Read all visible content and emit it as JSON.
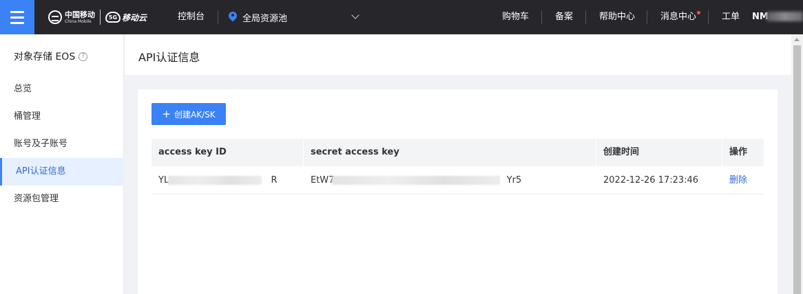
{
  "topbar": {
    "brand_cn": "中国移动",
    "brand_en": "China Mobile",
    "cloud_badge": "5G",
    "cloud_name": "移动云",
    "console": "控制台",
    "region": "全局资源池",
    "links": [
      "购物车",
      "备案",
      "帮助中心",
      "消息中心",
      "工单"
    ],
    "user_visible": "NM"
  },
  "sidebar": {
    "title": "对象存储 EOS",
    "help_glyph": "?",
    "items": [
      {
        "label": "总览"
      },
      {
        "label": "桶管理"
      },
      {
        "label": "账号及子账号"
      },
      {
        "label": "API认证信息"
      },
      {
        "label": "资源包管理"
      }
    ],
    "active_index": 3
  },
  "page": {
    "title": "API认证信息",
    "create_button": "创建AK/SK",
    "create_plus": "+"
  },
  "table": {
    "columns": [
      "access key ID",
      "secret access key",
      "创建时间",
      "操作"
    ],
    "rows": [
      {
        "access_key_start": "YL",
        "access_key_end": "R",
        "secret_start": "EtW7",
        "secret_end": "Yr5",
        "created": "2022-12-26 17:23:46",
        "action": "删除"
      }
    ]
  },
  "colors": {
    "topbar_bg": "#26262b",
    "accent": "#3b82f6",
    "link": "#2f6bd9",
    "notification_dot": "#ff4d4f"
  }
}
